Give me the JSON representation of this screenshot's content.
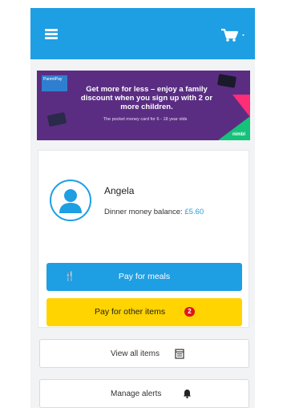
{
  "header": {
    "menu_icon": "hamburger-icon",
    "cart_icon": "cart-icon",
    "background_color": "#1e9ee3"
  },
  "banner": {
    "logo_text": "ParentPay",
    "headline": "Get more for less – enjoy a family discount when you sign up with 2 or more children.",
    "subline": "The pocket money card for 6 - 18 year olds",
    "tag": "nimbl"
  },
  "profile": {
    "name": "Angela",
    "balance_label": "Dinner money balance:",
    "balance_value": "£5.60",
    "avatar_icon": "user-icon"
  },
  "actions": {
    "pay_meals_label": "Pay for meals",
    "pay_meals_icon": "fork-knife-icon",
    "pay_other_label": "Pay for other items",
    "pay_other_badge": "2",
    "view_all_label": "View all items",
    "view_all_icon": "list-icon",
    "manage_alerts_label": "Manage alerts",
    "manage_alerts_icon": "bell-icon"
  },
  "colors": {
    "primary": "#1e9ee3",
    "accent_yellow": "#ffd400",
    "badge_red": "#e0151b",
    "banner_purple": "#5a2d82"
  }
}
